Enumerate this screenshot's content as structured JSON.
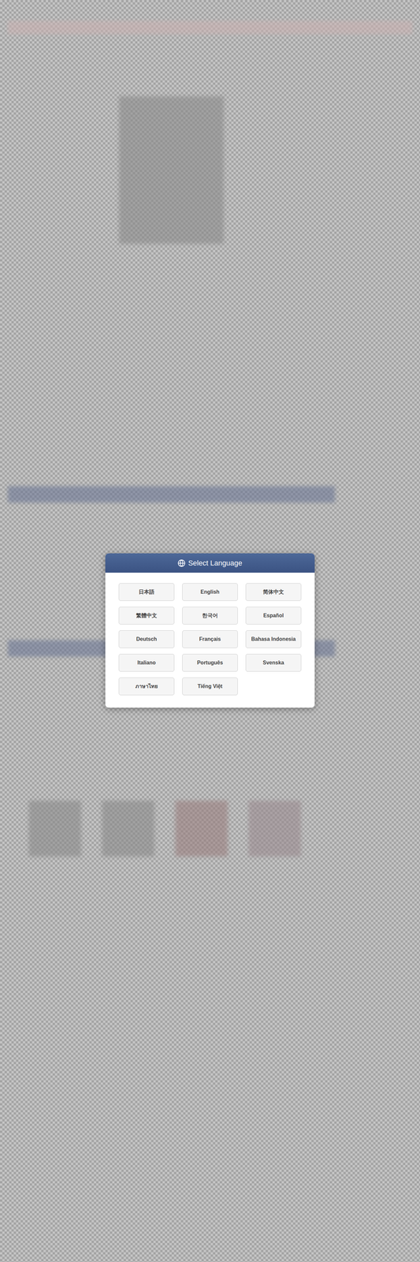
{
  "dialog": {
    "title": "Select Language"
  },
  "languages": [
    {
      "label": "日本語",
      "selected": false
    },
    {
      "label": "English",
      "selected": false
    },
    {
      "label": "简体中文",
      "selected": false
    },
    {
      "label": "繁體中文",
      "selected": false
    },
    {
      "label": "한국어",
      "selected": false
    },
    {
      "label": "Español",
      "selected": false
    },
    {
      "label": "Deutsch",
      "selected": false
    },
    {
      "label": "Français",
      "selected": false
    },
    {
      "label": "Bahasa Indonesia",
      "selected": false
    },
    {
      "label": "Italiano",
      "selected": false
    },
    {
      "label": "Português",
      "selected": false
    },
    {
      "label": "Svenska",
      "selected": false
    },
    {
      "label": "ภาษาไทย",
      "selected": false
    },
    {
      "label": "Tiếng Việt",
      "selected": false
    }
  ]
}
